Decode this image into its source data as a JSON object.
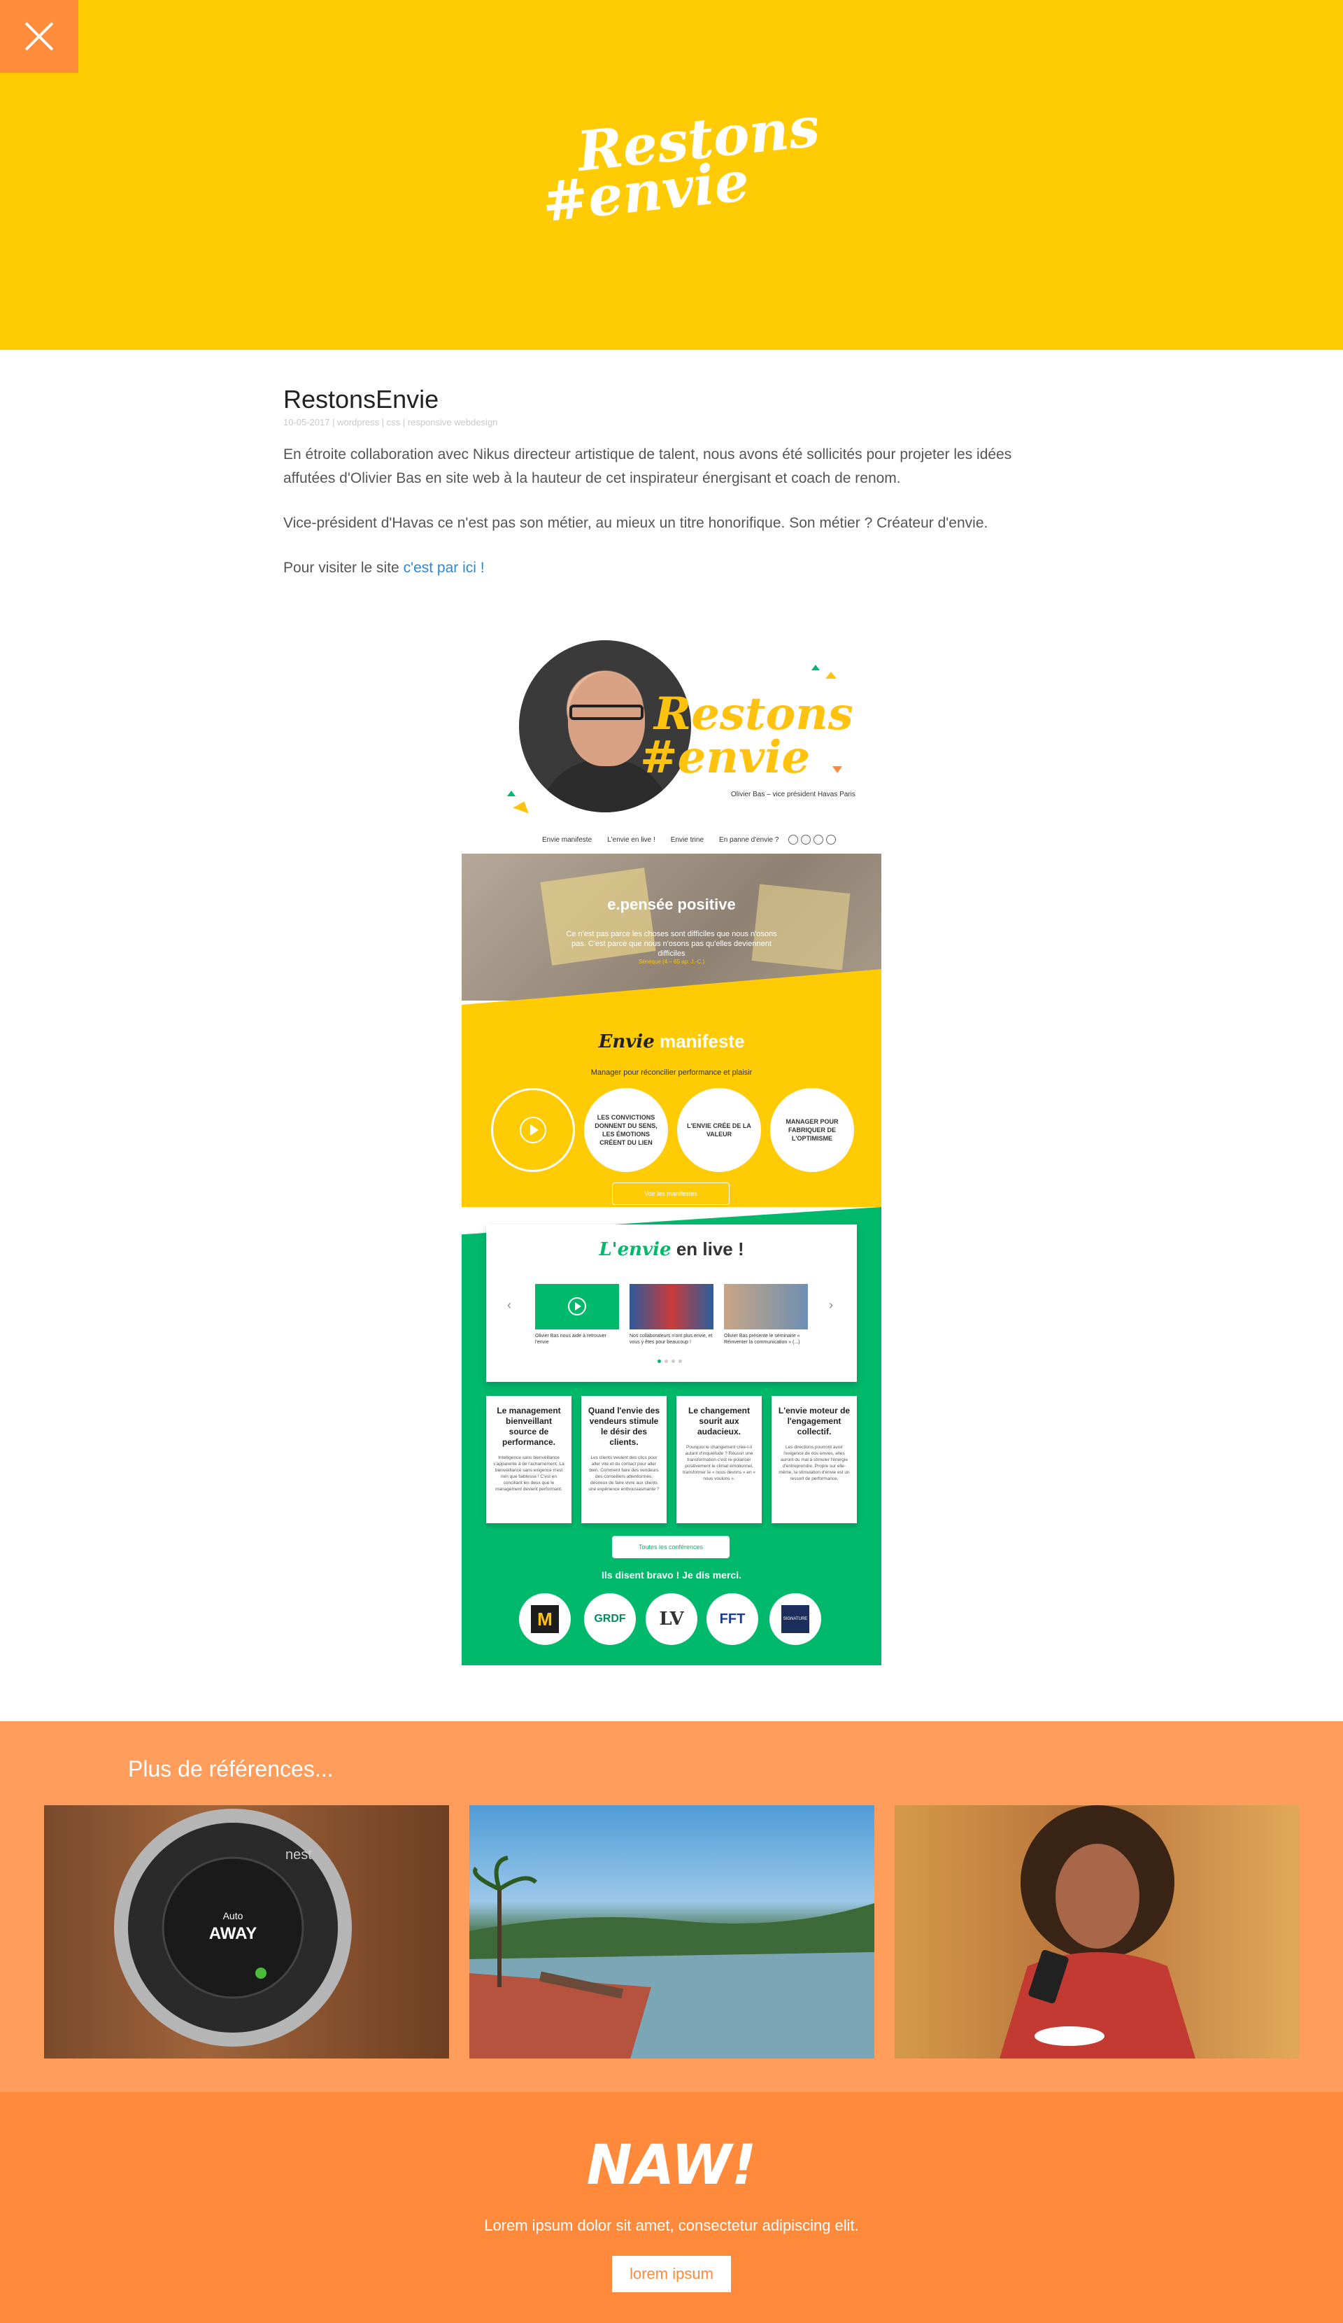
{
  "header": {
    "close_icon": "close-icon",
    "logo_line1": "Restons",
    "logo_line2": "#envie",
    "colors": {
      "background": "#ffcb05",
      "close_bg": "#ff8c3a"
    }
  },
  "article": {
    "title": "RestonsEnvie",
    "meta": "10-05-2017 | wordpress | css | responsive webdesign",
    "para1": "En étroite collaboration avec Nikus directeur artistique de talent, nous avons été sollicités pour projeter les idées affutées d'Olivier Bas en site web à la hauteur de cet inspirateur énergisant et coach de renom.",
    "para2": "Vice-président d'Havas ce n'est pas son métier, au mieux un titre honorifique. Son métier ? Créateur d'envie.",
    "visit_prefix": "Pour visiter le site ",
    "visit_link": "c'est par ici !"
  },
  "mockup": {
    "logo_line1": "Restons",
    "logo_line2": "#envie",
    "subtitle": "Olivier Bas – vice président Havas Paris",
    "nav": [
      "Envie manifeste",
      "L'envie en live !",
      "Envie trine",
      "En panne d'envie ?"
    ],
    "quote": {
      "title": "e.pensée positive",
      "text": "Ce n'est pas parce les choses sont difficiles que nous n'osons pas. C'est parce que nous n'osons pas qu'elles deviennent difficiles",
      "author": "Sénèque (4 – 65 ap. J.-C.)"
    },
    "manifeste": {
      "title_script": "Envie",
      "title": "manifeste",
      "subtitle": "Manager pour réconcilier performance et plaisir",
      "circles": [
        "LES CONVICTIONS DONNENT DU SENS, LES ÉMOTIONS CRÉENT DU LIEN",
        "L'ENVIE CRÉE DE LA VALEUR",
        "MANAGER POUR FABRIQUER DE L'OPTIMISME"
      ],
      "button": "Voir les manifestes"
    },
    "live": {
      "title_script": "L'envie",
      "title": "en live !",
      "videos": [
        "Olivier Bas nous aide à retrouver l'envie",
        "Nos collaborateurs n'ont plus envie, et vous y êtes pour beaucoup !",
        "Olivier Bas présente le séminaire « Réinventer la communication » (...)"
      ]
    },
    "conferences": [
      {
        "title": "Le management bienveillant source de performance.",
        "desc": "Intelligence sans bienveillance s'apparente à de l'acharnement. La bienveillance sans exigence n'est rien que faiblesse ! C'est en conciliant les deux que le management devient performant."
      },
      {
        "title": "Quand l'envie des vendeurs stimule le désir des clients.",
        "desc": "Les clients veulent des clics pour aller vite et du contact pour aller bien. Comment faire des vendeurs des conseillers attentionnés, désireux de faire vivre aux clients une expérience enthousiasmante ?"
      },
      {
        "title": "Le changement sourit aux audacieux.",
        "desc": "Pourquoi le changement crée-t-il autant d'inquiétude ? Réussir une transformation c'est re-polariser positivement le climat émotionnel, transformer le « nous devons » en « nous voulons »."
      },
      {
        "title": "L'envie moteur de l'engagement collectif.",
        "desc": "Les directions pourront avoir l'exigence de nos envies, elles auront du mal à stimuler l'énergie d'entreprendre. Propre sur elle-même, la stimulation d'envie est un ressort de performance."
      }
    ],
    "conf_button": "Toutes les conférences",
    "bravo": "Ils disent bravo ! Je dis merci.",
    "client_logos": [
      "M",
      "GRDF",
      "LV",
      "FFT",
      "SIGNATURE"
    ]
  },
  "references": {
    "title": "Plus de références...",
    "items": [
      "nest-thermostat",
      "tropical-beach",
      "woman-smartphone"
    ],
    "nest_text": {
      "brand": "nest",
      "line1": "Auto",
      "line2": "AWAY"
    }
  },
  "footer": {
    "logo": "NAW!",
    "text": "Lorem ipsum dolor sit amet, consectetur adipiscing elit.",
    "button": "lorem ipsum"
  }
}
